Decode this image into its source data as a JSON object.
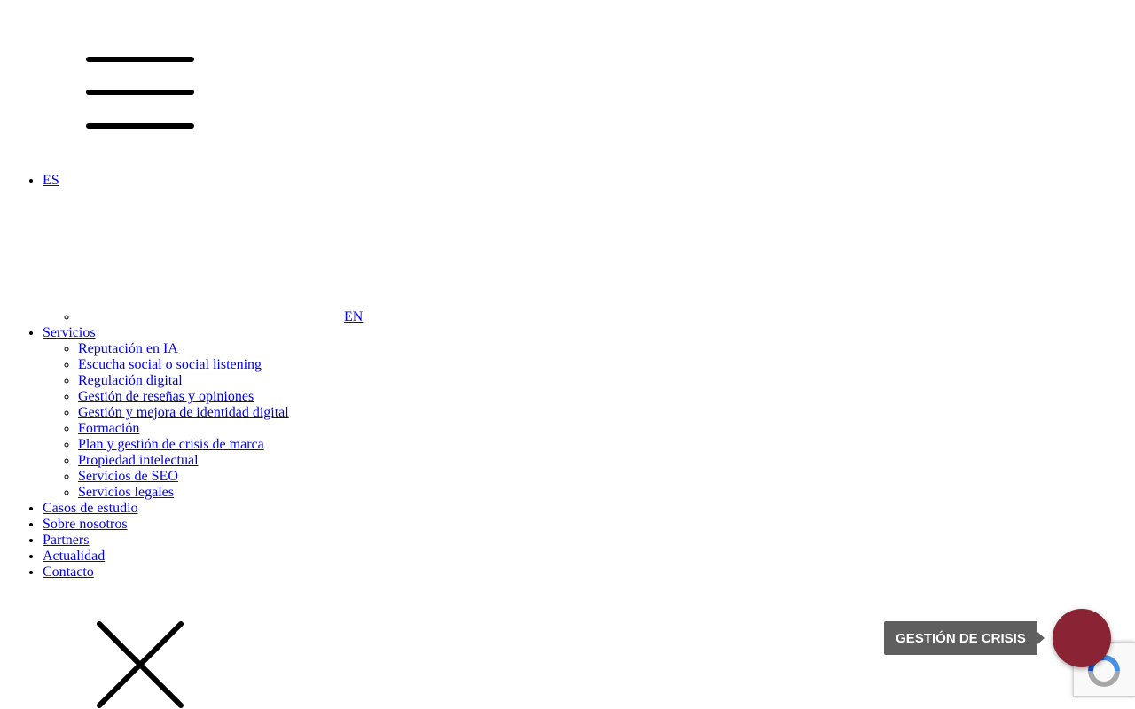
{
  "header": {
    "menu_toggle_icon": "hamburger-icon"
  },
  "nav": {
    "lang_current": "ES",
    "lang_alt": "EN",
    "services_label": "Servicios",
    "services": [
      "Reputación en IA",
      "Escucha social o social listening",
      "Regulación digital",
      "Gestión de reseñas y opiniones",
      "Gestión y mejora de identidad digital",
      "Formación",
      "Plan y gestión de crisis de marca",
      "Propiedad intelectual",
      "Servicios de SEO",
      "Servicios legales"
    ],
    "items": [
      "Casos de estudio",
      "Sobre nosotros",
      "Partners",
      "Actualidad",
      "Contacto"
    ],
    "close_icon": "close-icon"
  },
  "floating": {
    "crisis_label": "GESTIÓN DE CRISIS",
    "crisis_color": "#8a2434",
    "label_bg": "#5f5f5f",
    "recaptcha_icon": "recaptcha-icon"
  },
  "colors": {
    "link": "#0000ee",
    "text": "#000000",
    "background": "#ffffff"
  }
}
